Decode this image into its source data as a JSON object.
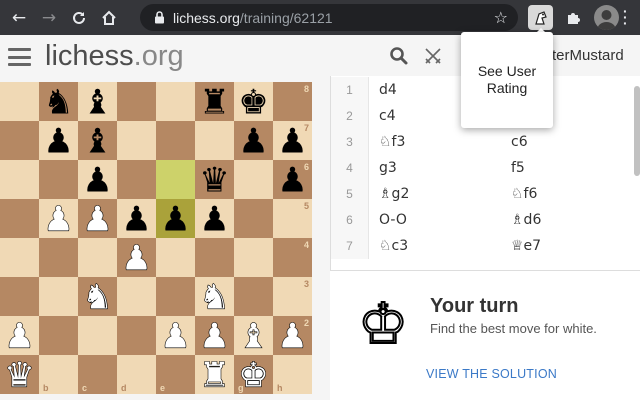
{
  "browser": {
    "url_host": "lichess.org",
    "url_path": "/training/62121",
    "back_icon": "arrow-left-icon",
    "forward_icon": "arrow-right-icon",
    "reload_icon": "reload-icon",
    "home_icon": "home-icon",
    "bookmark_icon": "star-icon"
  },
  "header": {
    "logo_main": "lichess",
    "logo_tld": ".org",
    "username": "terMustard"
  },
  "popup": {
    "text": "See User Rating"
  },
  "board": {
    "light_color": "#f0d9b5",
    "dark_color": "#b58863",
    "highlight_light": "#cdd26a",
    "highlight_dark": "#aaa23a",
    "ranks": [
      "8",
      "7",
      "6",
      "5",
      "4",
      "3",
      "2"
    ],
    "files": [
      "b",
      "c",
      "d",
      "e",
      "g",
      "h"
    ],
    "pieces": [
      {
        "sq": "b8",
        "p": "n",
        "c": "b"
      },
      {
        "sq": "c8",
        "p": "b",
        "c": "b"
      },
      {
        "sq": "f8",
        "p": "r",
        "c": "b"
      },
      {
        "sq": "g8",
        "p": "k",
        "c": "b"
      },
      {
        "sq": "b7",
        "p": "p",
        "c": "b"
      },
      {
        "sq": "c7",
        "p": "b",
        "c": "b"
      },
      {
        "sq": "g7",
        "p": "p",
        "c": "b"
      },
      {
        "sq": "h7",
        "p": "p",
        "c": "b"
      },
      {
        "sq": "c6",
        "p": "p",
        "c": "b"
      },
      {
        "sq": "f6",
        "p": "q",
        "c": "b"
      },
      {
        "sq": "h6",
        "p": "p",
        "c": "b"
      },
      {
        "sq": "b5",
        "p": "p",
        "c": "w"
      },
      {
        "sq": "c5",
        "p": "p",
        "c": "w"
      },
      {
        "sq": "d5",
        "p": "p",
        "c": "b"
      },
      {
        "sq": "e5",
        "p": "p",
        "c": "b"
      },
      {
        "sq": "f5",
        "p": "p",
        "c": "b"
      },
      {
        "sq": "d4",
        "p": "p",
        "c": "w"
      },
      {
        "sq": "c3",
        "p": "n",
        "c": "w"
      },
      {
        "sq": "f3",
        "p": "n",
        "c": "w"
      },
      {
        "sq": "a2",
        "p": "p",
        "c": "w"
      },
      {
        "sq": "e2",
        "p": "p",
        "c": "w"
      },
      {
        "sq": "f2",
        "p": "p",
        "c": "w"
      },
      {
        "sq": "g2",
        "p": "b",
        "c": "w"
      },
      {
        "sq": "h2",
        "p": "p",
        "c": "w"
      },
      {
        "sq": "a1",
        "p": "q",
        "c": "w"
      },
      {
        "sq": "f1",
        "p": "r",
        "c": "w"
      },
      {
        "sq": "g1",
        "p": "k",
        "c": "w"
      }
    ],
    "highlighted": [
      "e6",
      "e5"
    ]
  },
  "moves": [
    {
      "n": "1",
      "w": "d4",
      "b": ""
    },
    {
      "n": "2",
      "w": "c4",
      "b": ""
    },
    {
      "n": "3",
      "w": "♘f3",
      "b": "c6"
    },
    {
      "n": "4",
      "w": "g3",
      "b": "f5"
    },
    {
      "n": "5",
      "w": "♗g2",
      "b": "♘f6"
    },
    {
      "n": "6",
      "w": "O-O",
      "b": "♗d6"
    },
    {
      "n": "7",
      "w": "♘c3",
      "b": "♕e7"
    }
  ],
  "turn": {
    "title": "Your turn",
    "subtitle": "Find the best move for white.",
    "solution": "VIEW THE SOLUTION"
  }
}
